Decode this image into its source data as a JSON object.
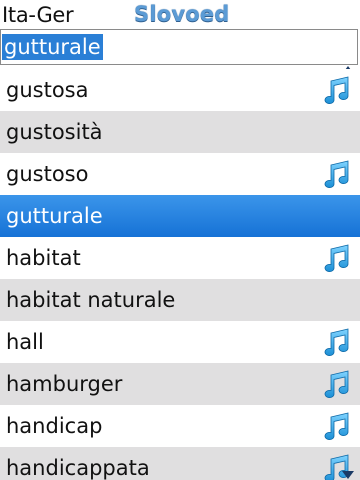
{
  "header": {
    "dictionary": "Ita-Ger",
    "brand": "Slovoed"
  },
  "search": {
    "value": "gutturale"
  },
  "entries": [
    {
      "label": "gustosa",
      "audio": true,
      "selected": false
    },
    {
      "label": "gustosità",
      "audio": false,
      "selected": false
    },
    {
      "label": "gustoso",
      "audio": true,
      "selected": false
    },
    {
      "label": "gutturale",
      "audio": false,
      "selected": true
    },
    {
      "label": "habitat",
      "audio": true,
      "selected": false
    },
    {
      "label": "habitat naturale",
      "audio": false,
      "selected": false
    },
    {
      "label": "hall",
      "audio": true,
      "selected": false
    },
    {
      "label": "hamburger",
      "audio": true,
      "selected": false
    },
    {
      "label": "handicap",
      "audio": true,
      "selected": false
    },
    {
      "label": "handicappata",
      "audio": true,
      "selected": false
    }
  ],
  "colors": {
    "brand": "#5b9bd5",
    "selection": "#1f7fe0",
    "stripe": "#e0dfe0",
    "note": "#2aa0e0"
  },
  "icons": {
    "audio": "music-note-icon",
    "scroll_up": "scroll-up-arrow-icon",
    "scroll_down": "scroll-down-arrow-icon"
  }
}
